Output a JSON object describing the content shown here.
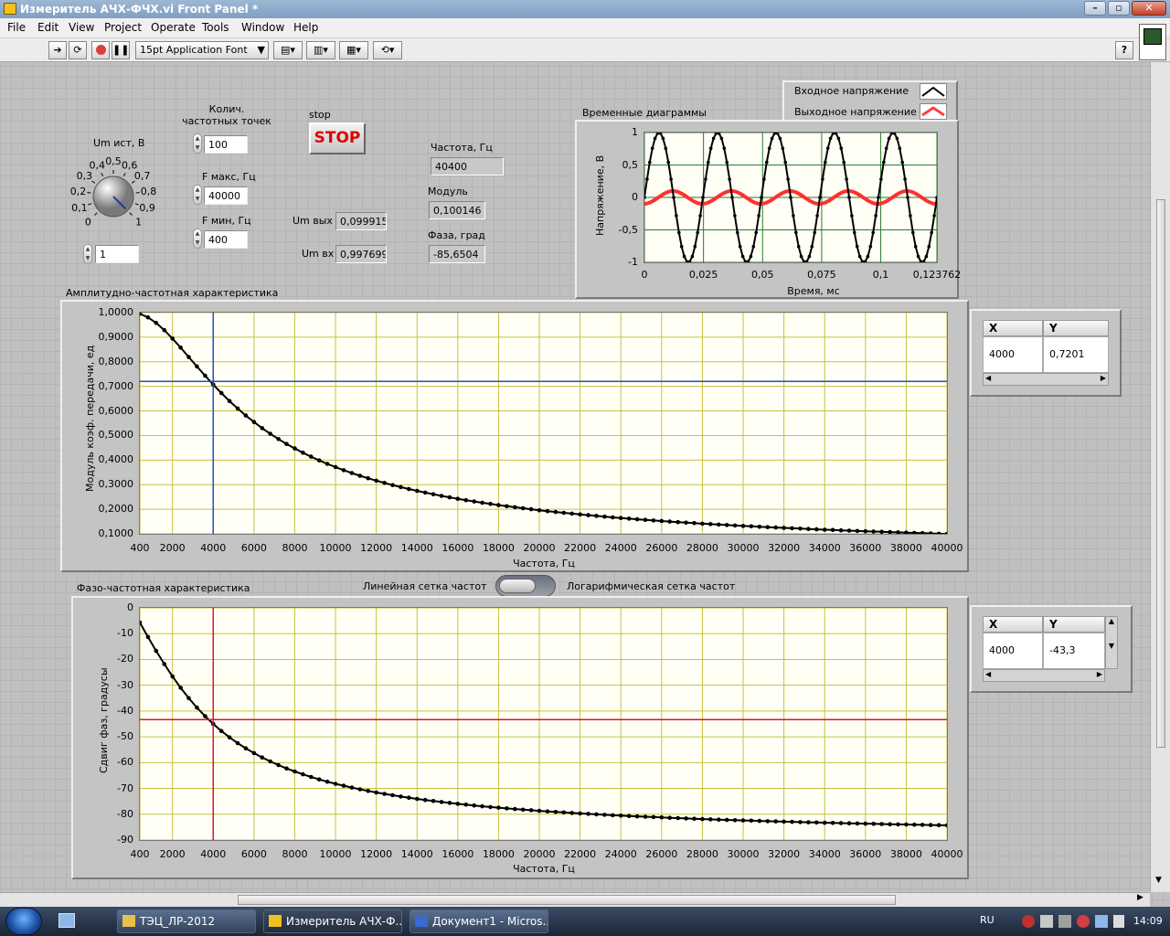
{
  "window": {
    "title": "Измеритель АЧХ-ФЧХ.vi Front Panel *"
  },
  "menu": [
    "File",
    "Edit",
    "View",
    "Project",
    "Operate",
    "Tools",
    "Window",
    "Help"
  ],
  "toolbar": {
    "font_label": "15pt Application Font",
    "help": "?"
  },
  "controls": {
    "um_label": "Um ист, В",
    "knob_value": "1",
    "knob_ticks": [
      "0",
      "0,1",
      "0,2",
      "0,3",
      "0,4",
      "0,5",
      "0,6",
      "0,7",
      "0,8",
      "0,9",
      "1"
    ],
    "count_label": "Колич.\nчастотных точек",
    "count_value": "100",
    "fmax_label": "F макс, Гц",
    "fmax_value": "40000",
    "fmin_label": "F мин, Гц",
    "fmin_value": "400",
    "stop_label": "stop",
    "stop_button": "STOP",
    "umout_label": "Um вых",
    "umout_value": "0,099915",
    "umin_label": "Um вх",
    "umin_value": "0,997699",
    "freq_label": "Частота, Гц",
    "freq_value": "40400",
    "mod_label": "Модуль",
    "mod_value": "0,100146",
    "phase_label": "Фаза, град",
    "phase_value": "-85,6504",
    "toggle_left": "Линейная сетка частот",
    "toggle_right": "Логарифмическая сетка частот"
  },
  "time_chart": {
    "title": "Временные диаграммы",
    "xlabel": "Время, мс",
    "ylabel": "Напряжение, В",
    "xticks": [
      "0",
      "0,025",
      "0,05",
      "0,075",
      "0,1",
      "0,123762"
    ],
    "yticks": [
      "1",
      "0,5",
      "0",
      "-0,5",
      "-1"
    ],
    "legend": [
      "Входное напряжение",
      "Выходное напряжение"
    ],
    "series_colors": [
      "#000000",
      "#ff3030"
    ]
  },
  "amp_chart": {
    "title": "Амплитудно-частотная характеристика",
    "xlabel": "Частота, Гц",
    "ylabel": "Модуль коэф. передачи, ед",
    "xticks": [
      "400",
      "2000",
      "4000",
      "6000",
      "8000",
      "10000",
      "12000",
      "14000",
      "16000",
      "18000",
      "20000",
      "22000",
      "24000",
      "26000",
      "28000",
      "30000",
      "32000",
      "34000",
      "36000",
      "38000",
      "40000"
    ],
    "yticks": [
      "1,0000",
      "0,9000",
      "0,8000",
      "0,7000",
      "0,6000",
      "0,5000",
      "0,4000",
      "0,3000",
      "0,2000",
      "0,1000"
    ],
    "cursor": {
      "x_head": "X",
      "y_head": "Y",
      "x": "4000",
      "y": "0,7201",
      "color": "#1f4fd0"
    }
  },
  "phase_chart": {
    "title": "Фазо-частотная характеристика",
    "xlabel": "Частота, Гц",
    "ylabel": "Сдвиг фаз, градусы",
    "xticks": [
      "400",
      "2000",
      "4000",
      "6000",
      "8000",
      "10000",
      "12000",
      "14000",
      "16000",
      "18000",
      "20000",
      "22000",
      "24000",
      "26000",
      "28000",
      "30000",
      "32000",
      "34000",
      "36000",
      "38000",
      "40000"
    ],
    "yticks": [
      "0",
      "-10",
      "-20",
      "-30",
      "-40",
      "-50",
      "-60",
      "-70",
      "-80",
      "-90"
    ],
    "cursor": {
      "x_head": "X",
      "y_head": "Y",
      "x": "4000",
      "y": "-43,3",
      "color": "#e01030"
    }
  },
  "chart_data": [
    {
      "type": "line",
      "title": "Временные диаграммы",
      "xlabel": "Время, мс",
      "ylabel": "Напряжение, В",
      "xlim": [
        0,
        0.123762
      ],
      "ylim": [
        -1,
        1
      ],
      "series": [
        {
          "name": "Входное напряжение",
          "amplitude": 1,
          "frequency_khz": 40.4
        },
        {
          "name": "Выходное напряжение",
          "amplitude": 0.1,
          "frequency_khz": 40.4,
          "phase_deg": -85.65
        }
      ]
    },
    {
      "type": "line",
      "title": "Амплитудно-частотная характеристика",
      "xlabel": "Частота, Гц",
      "ylabel": "Модуль коэф. передачи, ед",
      "xlim": [
        400,
        40000
      ],
      "ylim": [
        0.1,
        1
      ],
      "fc_hz": 4000,
      "points": 100,
      "series": [
        {
          "formula": "1/sqrt(1+(f/4000)^2)"
        }
      ],
      "cursor": [
        4000,
        0.7201
      ]
    },
    {
      "type": "line",
      "title": "Фазо-частотная характеристика",
      "xlabel": "Частота, Гц",
      "ylabel": "Сдвиг фаз, градусы",
      "xlim": [
        400,
        40000
      ],
      "ylim": [
        -90,
        0
      ],
      "fc_hz": 4000,
      "points": 100,
      "series": [
        {
          "formula": "-atan(f/4000)"
        }
      ],
      "cursor": [
        4000,
        -43.3
      ]
    }
  ],
  "taskbar": {
    "items": [
      "ТЭЦ_ЛР-2012",
      "Измеритель АЧХ-Ф...",
      "Документ1 - Micros..."
    ],
    "lang": "RU",
    "time": "14:09"
  }
}
